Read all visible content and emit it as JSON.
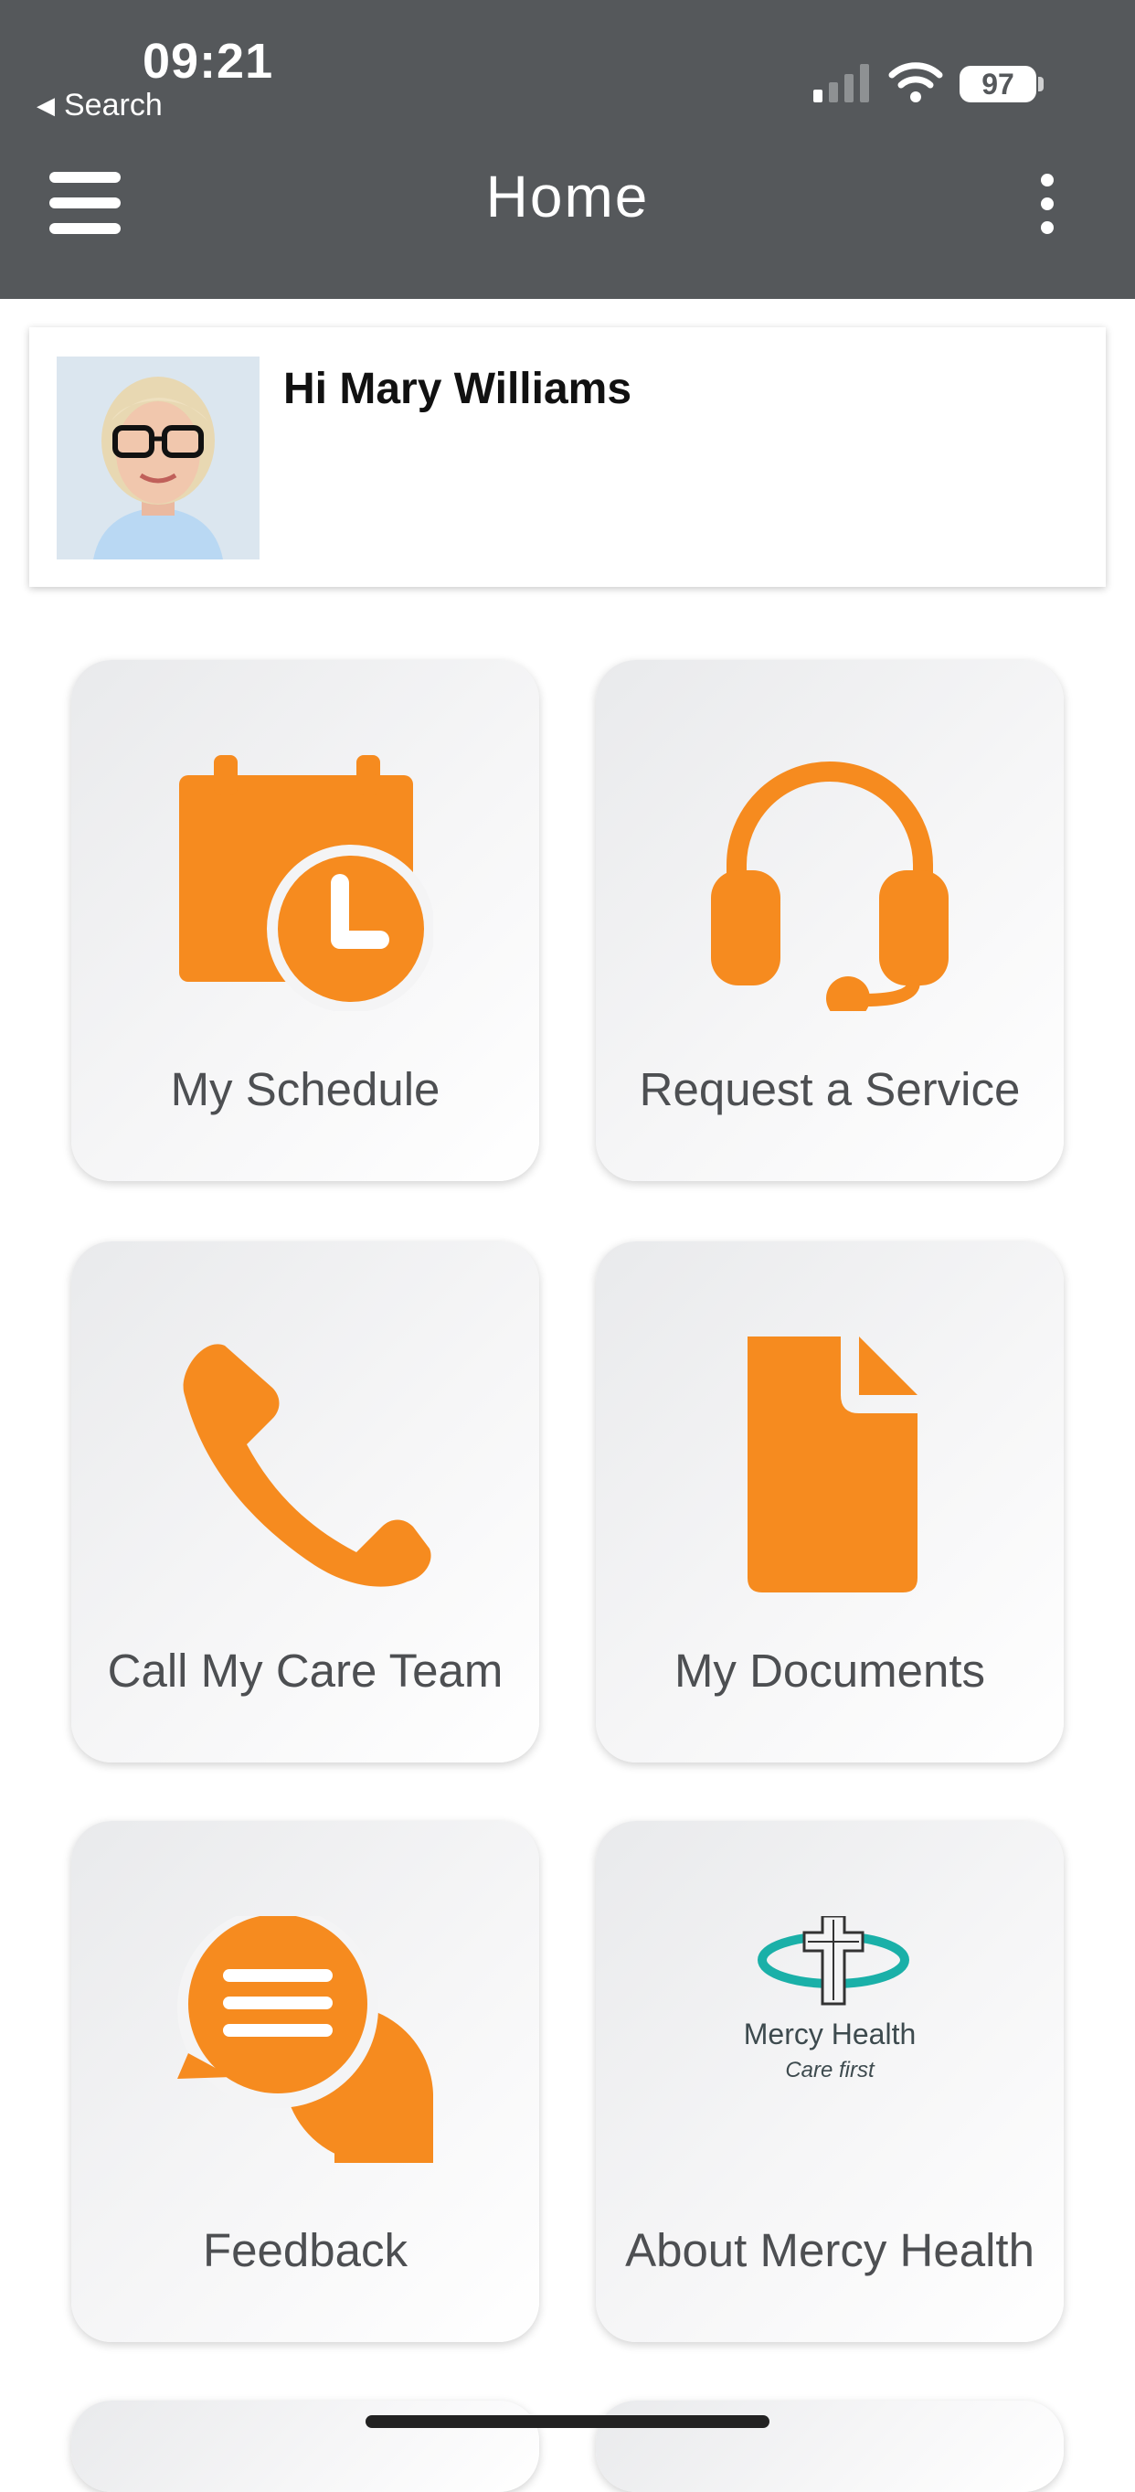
{
  "status_bar": {
    "time": "09:21",
    "back_label": "Search",
    "battery": "97"
  },
  "header": {
    "title": "Home"
  },
  "profile": {
    "greeting": "Hi Mary Williams"
  },
  "tiles": [
    {
      "label": "My Schedule",
      "icon": "calendar-clock-icon"
    },
    {
      "label": "Request a Service",
      "icon": "headset-icon"
    },
    {
      "label": "Call My Care Team",
      "icon": "phone-icon"
    },
    {
      "label": "My Documents",
      "icon": "document-icon"
    },
    {
      "label": "Feedback",
      "icon": "chat-bubbles-icon"
    },
    {
      "label": "About Mercy Health",
      "icon": "mercy-health-logo"
    }
  ],
  "logo": {
    "name": "Mercy Health",
    "tagline": "Care first"
  },
  "colors": {
    "header_bg": "#55585b",
    "accent": "#f68b1f",
    "tile_label": "#4d4f52"
  }
}
